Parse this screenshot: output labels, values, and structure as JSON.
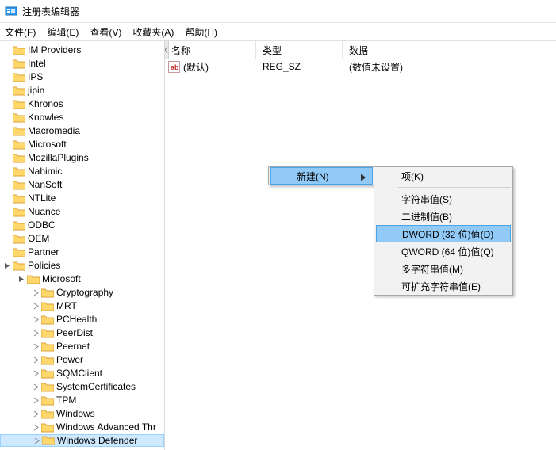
{
  "window": {
    "title": "注册表编辑器"
  },
  "menubar": {
    "file": "文件(F)",
    "edit": "编辑(E)",
    "view": "查看(V)",
    "favorites": "收藏夹(A)",
    "help": "帮助(H)"
  },
  "headers": {
    "name": "名称",
    "type": "类型",
    "data": "数据"
  },
  "row0": {
    "name": "(默认)",
    "type": "REG_SZ",
    "data": "(数值未设置)"
  },
  "tree": {
    "top": [
      "IM Providers",
      "Intel",
      "IPS",
      "jipin",
      "Khronos",
      "Knowles",
      "Macromedia",
      "Microsoft",
      "MozillaPlugins",
      "Nahimic",
      "NanSoft",
      "NTLite",
      "Nuance",
      "ODBC",
      "OEM",
      "Partner",
      "Policies"
    ],
    "policies_child": "Microsoft",
    "ms_children": [
      "Cryptography",
      "MRT",
      "PCHealth",
      "PeerDist",
      "Peernet",
      "Power",
      "SQMClient",
      "SystemCertificates",
      "TPM",
      "Windows",
      "Windows Advanced Thr",
      "Windows Defender"
    ]
  },
  "ctx_parent": {
    "new": "新建(N)"
  },
  "ctx_child": {
    "key": "项(K)",
    "string": "字符串值(S)",
    "binary": "二进制值(B)",
    "dword": "DWORD (32 位)值(D)",
    "qword": "QWORD (64 位)值(Q)",
    "multi": "多字符串值(M)",
    "expand": "可扩充字符串值(E)"
  }
}
